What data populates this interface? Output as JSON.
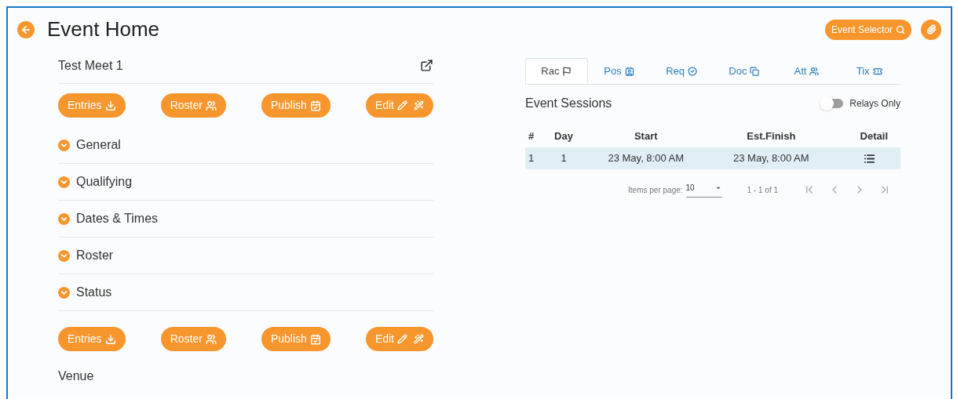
{
  "header": {
    "title": "Event Home",
    "event_selector": "Event Selector"
  },
  "meet": {
    "name": "Test Meet 1"
  },
  "action_buttons_top": [
    {
      "label": "Entries",
      "kind": "download"
    },
    {
      "label": "Roster",
      "kind": "users"
    },
    {
      "label": "Publish",
      "kind": "calendar"
    },
    {
      "label": "Edit",
      "kind": "edit"
    }
  ],
  "sections": [
    {
      "label": "General",
      "expanded": false
    },
    {
      "label": "Qualifying",
      "expanded": false
    },
    {
      "label": "Dates & Times",
      "expanded": false
    },
    {
      "label": "Roster",
      "expanded": false
    },
    {
      "label": "Status",
      "expanded": false
    }
  ],
  "action_buttons_bottom": [
    {
      "label": "Entries",
      "kind": "download"
    },
    {
      "label": "Roster",
      "kind": "users"
    },
    {
      "label": "Publish",
      "kind": "calendar"
    },
    {
      "label": "Edit",
      "kind": "edit"
    }
  ],
  "venue": {
    "label": "Venue"
  },
  "tabs": [
    {
      "label": "Rac",
      "kind": "flag",
      "selected": true
    },
    {
      "label": "Pos",
      "kind": "badge",
      "selected": false
    },
    {
      "label": "Req",
      "kind": "check",
      "selected": false
    },
    {
      "label": "Doc",
      "kind": "copy",
      "selected": false
    },
    {
      "label": "Att",
      "kind": "users",
      "selected": false
    },
    {
      "label": "Tix",
      "kind": "ticket",
      "selected": false
    }
  ],
  "sessions": {
    "title": "Event Sessions",
    "relays_only": {
      "label": "Relays Only",
      "on": false
    },
    "columns": [
      "#",
      "Day",
      "Start",
      "Est.Finish",
      "Detail"
    ],
    "rows": [
      {
        "cells": [
          "1",
          "1",
          "23 May, 8:00 AM",
          "23 May, 8:00 AM"
        ],
        "selected": true
      }
    ],
    "paginator": {
      "items_per_page_label": "Items per page:",
      "items_per_page": "10",
      "range": "1 - 1 of 1"
    }
  }
}
